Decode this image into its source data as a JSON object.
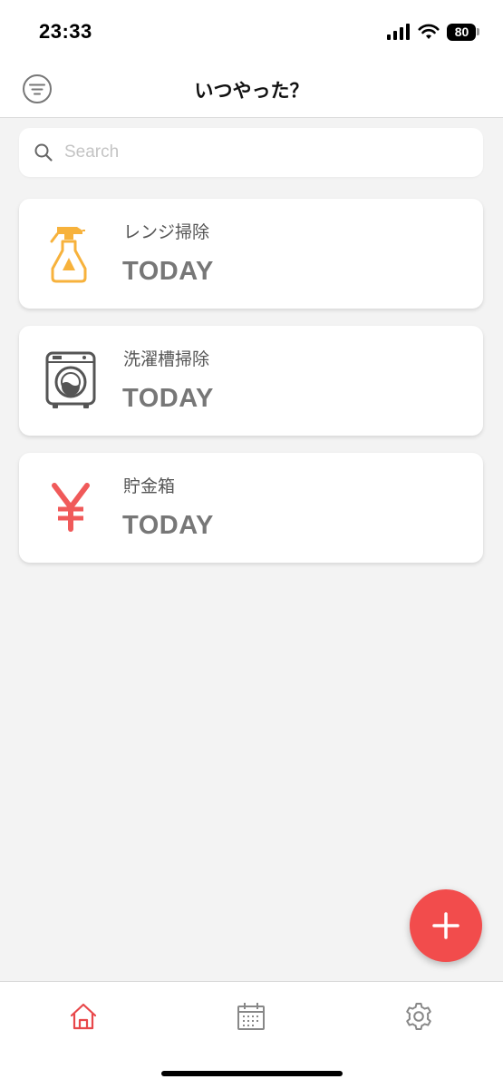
{
  "status_bar": {
    "time": "23:33",
    "battery": "80"
  },
  "header": {
    "title": "いつやった？",
    "filter_icon": "filter-icon"
  },
  "search": {
    "placeholder": "Search",
    "value": ""
  },
  "tasks": [
    {
      "name": "レンジ掃除",
      "status": "TODAY",
      "icon": "spray-bottle-icon",
      "color": "#f7b23c"
    },
    {
      "name": "洗濯槽掃除",
      "status": "TODAY",
      "icon": "washing-machine-icon",
      "color": "#555555"
    },
    {
      "name": "貯金箱",
      "status": "TODAY",
      "icon": "yen-icon",
      "color": "#f05a5a"
    }
  ],
  "fab": {
    "icon": "plus-icon",
    "color": "#f24c4c"
  },
  "tabbar": {
    "items": [
      {
        "icon": "home-icon",
        "active": true
      },
      {
        "icon": "calendar-icon",
        "active": false
      },
      {
        "icon": "settings-icon",
        "active": false
      }
    ],
    "active_color": "#e8474a"
  }
}
